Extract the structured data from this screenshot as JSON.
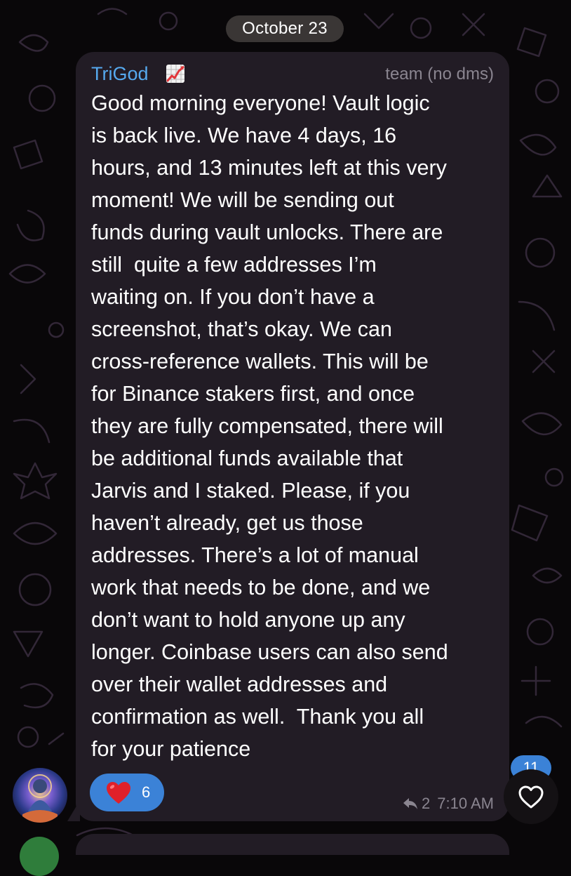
{
  "chat": {
    "date_separator": "October 23"
  },
  "message": {
    "sender_name": "TriGod",
    "sender_emoji_icon": "chart-increasing-icon",
    "sender_title": "team (no dms)",
    "text": "Good morning everyone! Vault logic\nis back live. We have 4 days, 16\nhours, and 13 minutes left at this very\nmoment! We will be sending out\nfunds during vault unlocks. There are\nstill  quite a few addresses I’m\nwaiting on. If you don’t have a\nscreenshot, that’s okay. We can\ncross-reference wallets. This will be\nfor Binance stakers first, and once\nthey are fully compensated, there will\nbe additional funds available that\nJarvis and I staked. Please, if you\nhaven’t already, get us those\naddresses. There’s a lot of manual\nwork that needs to be done, and we\ndon’t want to hold anyone up any\nlonger. Coinbase users can also send\nover their wallet addresses and\nconfirmation as well.  Thank you all\nfor your patience",
    "reaction": {
      "icon": "red-heart-icon",
      "count": "6"
    },
    "reply_count": "2",
    "time": "7:10 AM"
  },
  "scroll_button": {
    "unread_count": "11",
    "icon": "heart-outline-icon"
  },
  "colors": {
    "background": "#090709",
    "bubble": "#221c25",
    "sender_name": "#56a9ee",
    "accent": "#3b82d7",
    "meta_text": "#8a8590"
  }
}
